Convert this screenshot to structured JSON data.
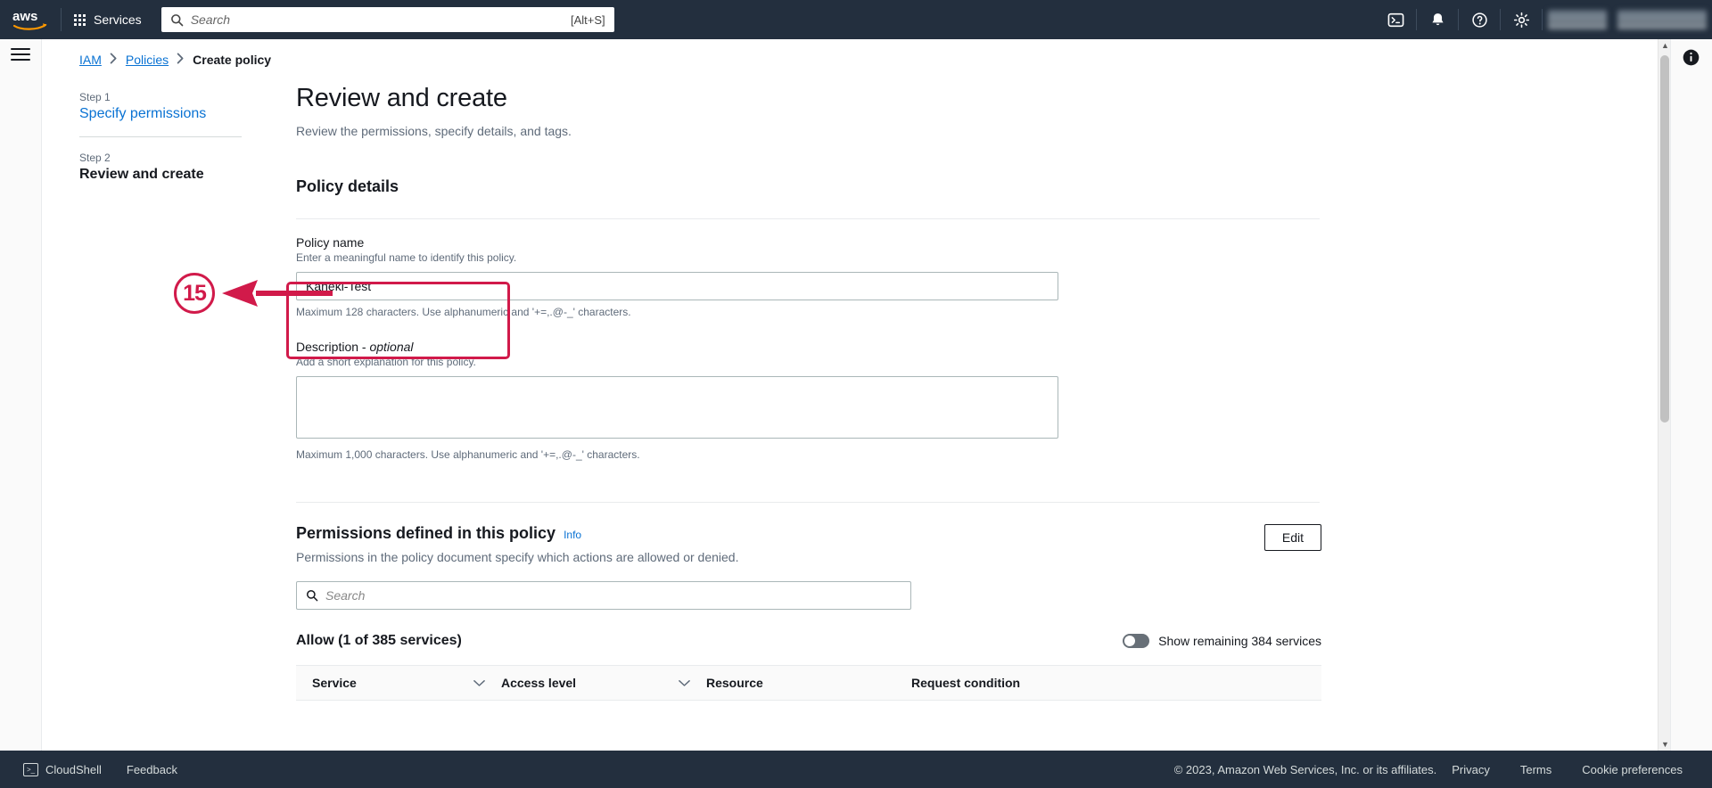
{
  "topnav": {
    "logo_alt": "aws",
    "services_label": "Services",
    "search_placeholder": "Search",
    "search_value": "",
    "search_shortcut": "[Alt+S]",
    "icons": [
      "cloudshell-icon",
      "notifications-bell-icon",
      "help-question-icon",
      "settings-gear-icon"
    ]
  },
  "breadcrumb": {
    "items": [
      {
        "label": "IAM",
        "link": true
      },
      {
        "label": "Policies",
        "link": true
      },
      {
        "label": "Create policy",
        "link": false
      }
    ],
    "separator": "›"
  },
  "wizard": {
    "steps": [
      {
        "number": "Step 1",
        "label": "Specify permissions",
        "current": false
      },
      {
        "number": "Step 2",
        "label": "Review and create",
        "current": true
      }
    ]
  },
  "page": {
    "title": "Review and create",
    "subtitle": "Review the permissions, specify details, and tags."
  },
  "policy_details": {
    "section_title": "Policy details",
    "name_label": "Policy name",
    "name_desc": "Enter a meaningful name to identify this policy.",
    "name_value": "Kaneki-Test",
    "name_placeholder": "",
    "name_help": "Maximum 128 characters. Use alphanumeric and '+=,.@-_' characters.",
    "description_label": "Description - ",
    "description_optional": "optional",
    "description_desc": "Add a short explanation for this policy.",
    "description_value": "",
    "description_placeholder": "",
    "description_help": "Maximum 1,000 characters. Use alphanumeric and '+=,.@-_' characters."
  },
  "annotation": {
    "marker_number": "15",
    "color": "#d11a4a"
  },
  "permissions": {
    "title": "Permissions defined in this policy",
    "info_label": "Info",
    "subtitle": "Permissions in the policy document specify which actions are allowed or denied.",
    "edit_label": "Edit",
    "search_placeholder": "Search",
    "search_value": "",
    "allow_label": "Allow (1 of 385 services)",
    "toggle_label": "Show remaining 384 services",
    "toggle_on": false,
    "columns": [
      {
        "label": "Service",
        "sortable": true
      },
      {
        "label": "Access level",
        "sortable": true
      },
      {
        "label": "Resource",
        "sortable": false
      },
      {
        "label": "Request condition",
        "sortable": false
      }
    ]
  },
  "footer": {
    "cloudshell_label": "CloudShell",
    "feedback_label": "Feedback",
    "copyright": "© 2023, Amazon Web Services, Inc. or its affiliates.",
    "links": [
      "Privacy",
      "Terms",
      "Cookie preferences"
    ]
  }
}
